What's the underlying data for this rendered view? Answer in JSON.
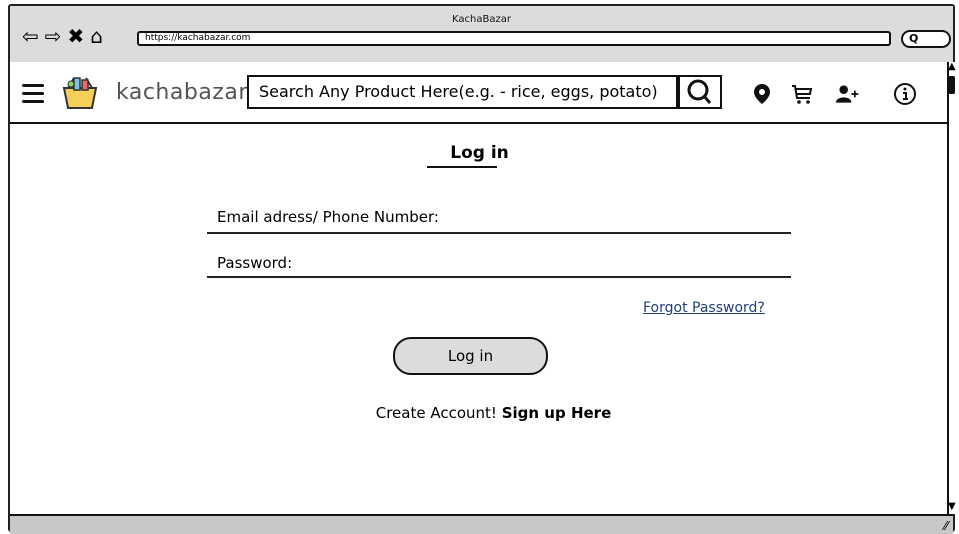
{
  "browser": {
    "window_title": "KachaBazar",
    "url": "https://kachabazar.com"
  },
  "header": {
    "brand": "kachabazar",
    "search_placeholder": "Search Any Product Here(e.g. - rice, eggs, potato)",
    "icons": [
      "menu-icon",
      "basket-logo-icon",
      "search-icon",
      "location-pin-icon",
      "cart-icon",
      "add-user-icon",
      "info-icon"
    ]
  },
  "login": {
    "title": "Log in",
    "email_label": "Email adress/ Phone Number:",
    "password_label": "Password:",
    "forgot_link": "Forgot Password?",
    "login_button": "Log in",
    "create_account_text": "Create Account!",
    "signup_link": "Sign up Here"
  }
}
